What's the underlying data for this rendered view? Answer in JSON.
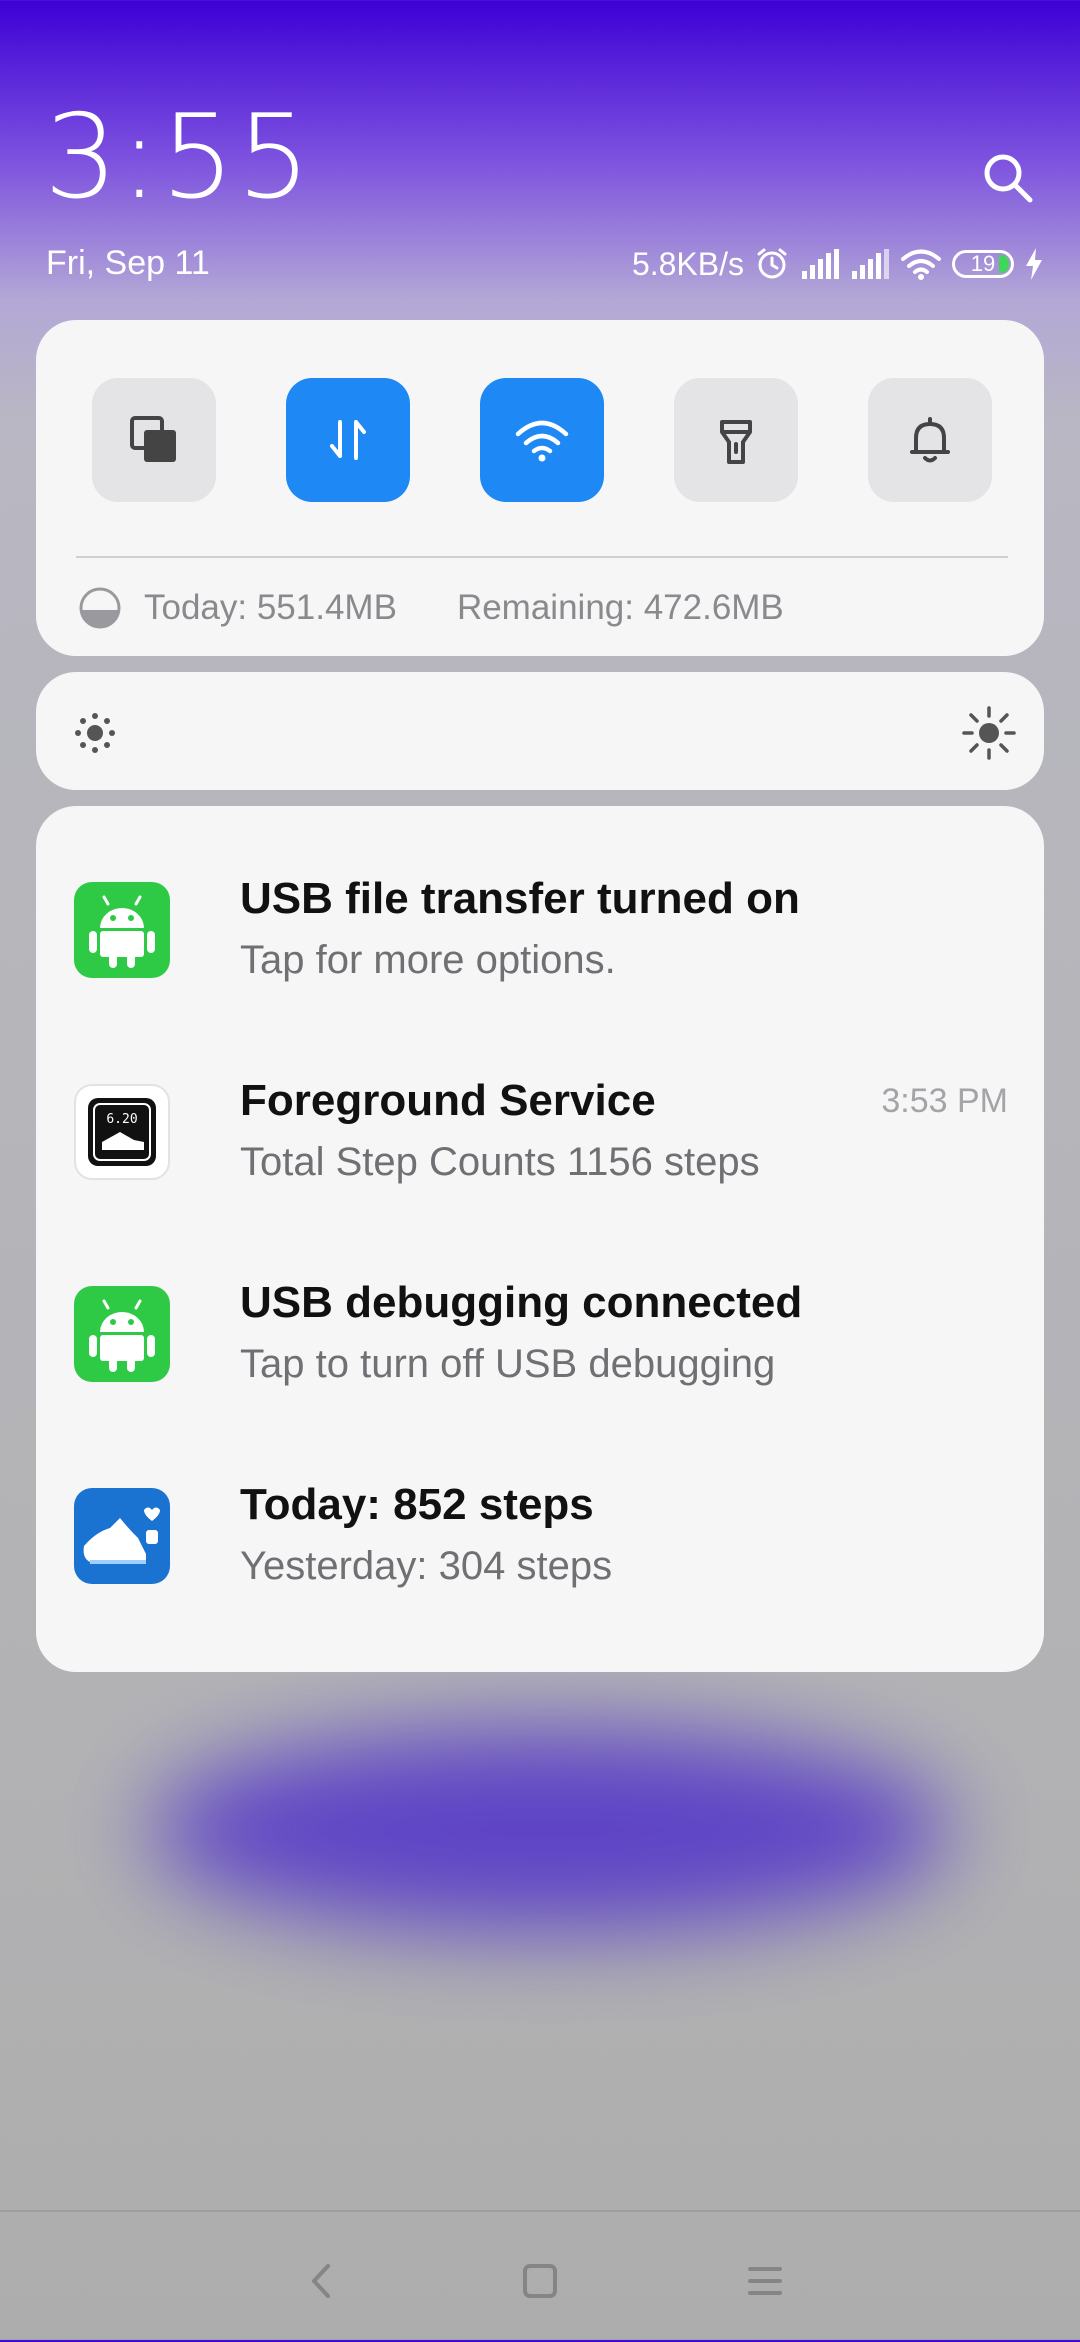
{
  "header": {
    "time": "3:55",
    "date": "Fri, Sep 11"
  },
  "status": {
    "net_speed": "5.8KB/s",
    "battery_level": "19",
    "icons": [
      "alarm-icon",
      "signal-icon",
      "signal-icon",
      "wifi-icon",
      "battery-icon",
      "charging-icon"
    ]
  },
  "quick_settings": {
    "tiles": [
      {
        "name": "screenshot",
        "active": false
      },
      {
        "name": "mobile-data",
        "active": true
      },
      {
        "name": "wifi",
        "active": true
      },
      {
        "name": "flashlight",
        "active": false
      },
      {
        "name": "sound",
        "active": false
      }
    ],
    "today_usage": "Today: 551.4MB",
    "remaining": "Remaining: 472.6MB"
  },
  "notifications": [
    {
      "app_icon": "android-icon",
      "title": "USB file transfer turned on",
      "body": "Tap for more options.",
      "time": ""
    },
    {
      "app_icon": "step-counter-icon",
      "title": "Foreground Service",
      "body": "Total Step Counts 1156 steps",
      "time": "3:53 PM"
    },
    {
      "app_icon": "android-icon",
      "title": "USB debugging connected",
      "body": "Tap to turn off USB debugging",
      "time": ""
    },
    {
      "app_icon": "pedometer-icon",
      "title": "Today: 852 steps",
      "body": "Yesterday: 304 steps",
      "time": ""
    }
  ],
  "colors": {
    "accent": "#1e88f5",
    "top_gradient": "#3d00d6",
    "card_bg": "#f6f6f7",
    "android_green": "#2fca45"
  }
}
